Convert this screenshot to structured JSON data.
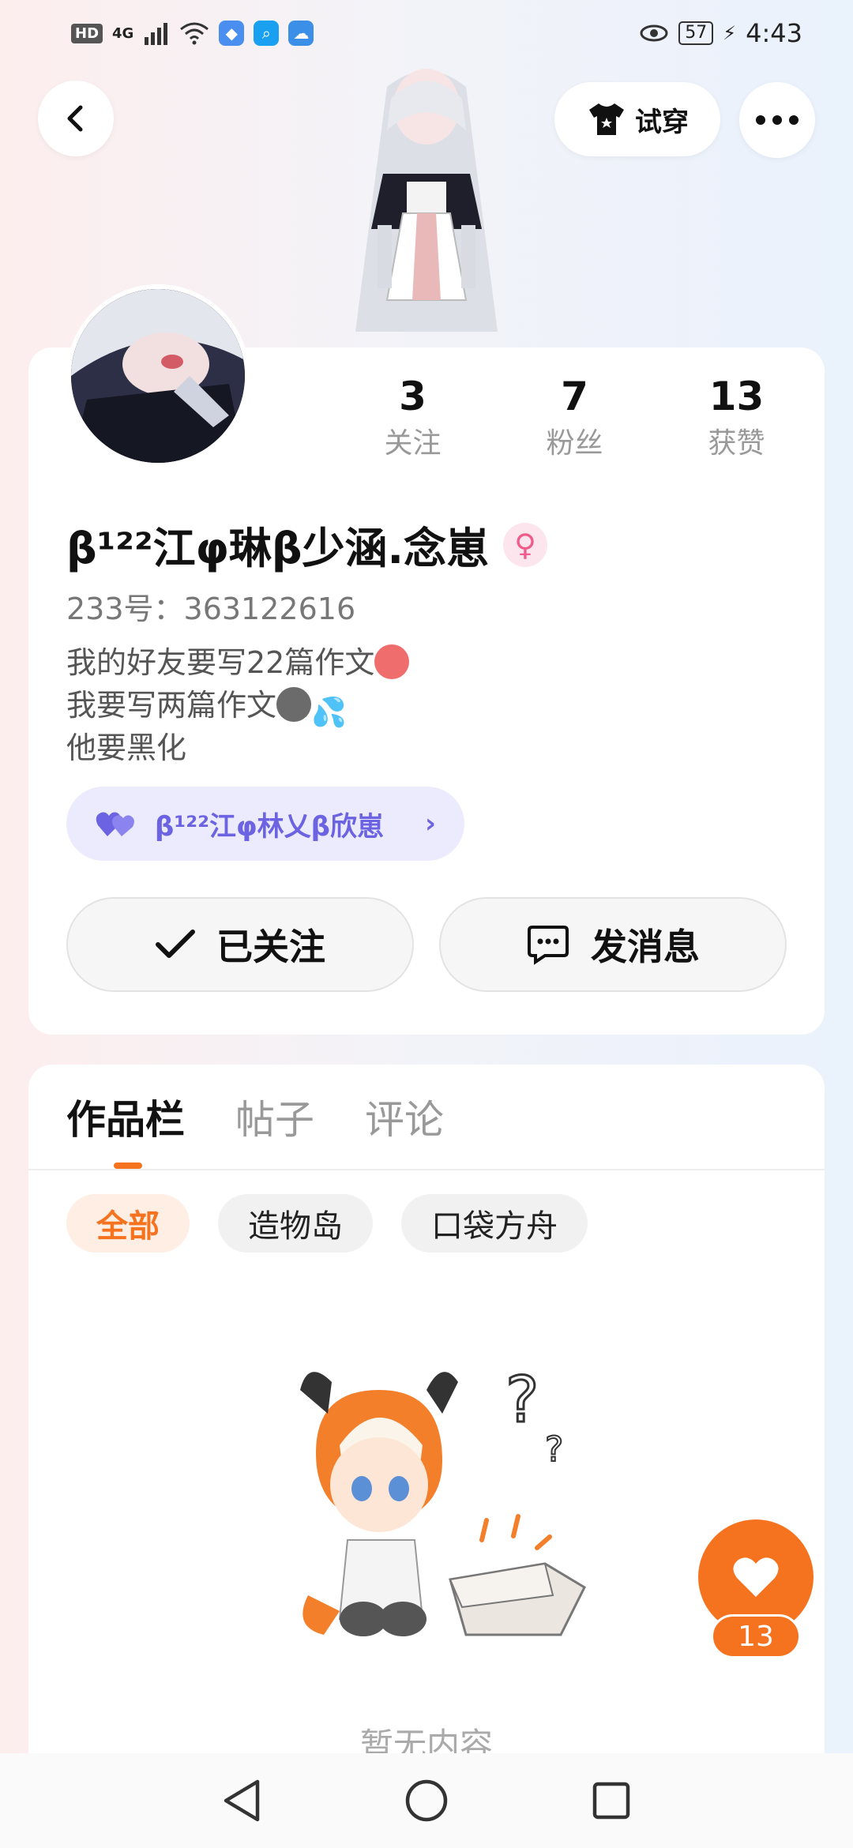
{
  "status_bar": {
    "hd": "HD",
    "network": "4G",
    "battery": "57",
    "time": "4:43"
  },
  "header": {
    "try_on_label": "试穿"
  },
  "profile": {
    "stats": [
      {
        "count": "3",
        "label": "关注"
      },
      {
        "count": "7",
        "label": "粉丝"
      },
      {
        "count": "13",
        "label": "获赞"
      }
    ],
    "nickname": "β¹²²江φ琳β少涵.念崽",
    "gender_symbol": "♀",
    "user_id": "233号：363122616",
    "bio": [
      "我的好友要写22篇作文",
      "我要写两篇作文",
      "他要黑化"
    ],
    "friend_pill": {
      "name": "β¹²²江φ林乂β欣崽"
    },
    "follow_label": "已关注",
    "message_label": "发消息"
  },
  "works": {
    "tabs": [
      "作品栏",
      "帖子",
      "评论"
    ],
    "active_tab": "作品栏",
    "filters": [
      "全部",
      "造物岛",
      "口袋方舟"
    ],
    "active_filter": "全部",
    "empty_text": "暂无内容"
  },
  "like_fab": {
    "count": "13"
  },
  "colors": {
    "accent": "#f5731f",
    "friend_purple": "#6c63e2",
    "gender_pink": "#ef5c8b"
  }
}
